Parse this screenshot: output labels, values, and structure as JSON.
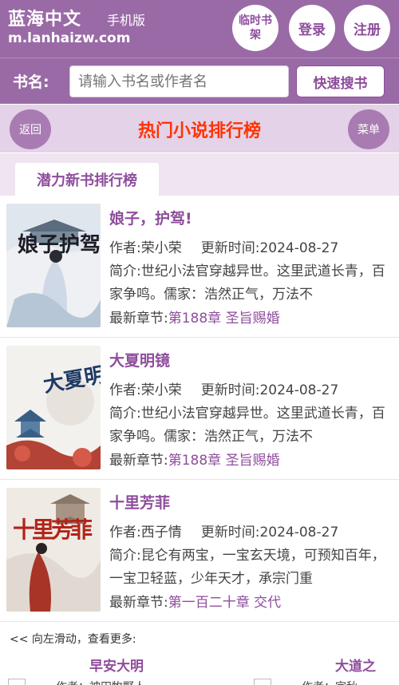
{
  "header": {
    "site_name": "蓝海中文",
    "site_sub": "手机版",
    "site_url": "m.lanhaizw.com",
    "btn_shelf": "临时书架",
    "btn_login": "登录",
    "btn_register": "注册"
  },
  "search": {
    "label": "书名:",
    "placeholder": "请输入书名或作者名",
    "button": "快速搜书"
  },
  "titlebar": {
    "back": "返回",
    "title": "热门小说排行榜",
    "menu": "菜单"
  },
  "tab": {
    "label": "潜力新书排行榜"
  },
  "books": [
    {
      "title": "娘子，护驾!",
      "author_label": "作者:",
      "author": "荣小荣",
      "update_label": "更新时间:",
      "update": "2024-08-27",
      "intro_label": "简介:",
      "intro": "世纪小法官穿越异世。这里武道长青，百家争鸣。儒家：浩然正气，万法不",
      "chapter_label": "最新章节:",
      "chapter": "第188章 圣旨赐婚",
      "cover_text": "娘子护驾"
    },
    {
      "title": "大夏明镜",
      "author_label": "作者:",
      "author": "荣小荣",
      "update_label": "更新时间:",
      "update": "2024-08-27",
      "intro_label": "简介:",
      "intro": "世纪小法官穿越异世。这里武道长青，百家争鸣。儒家：浩然正气，万法不",
      "chapter_label": "最新章节:",
      "chapter": "第188章 圣旨赐婚",
      "cover_text": "大夏明镜"
    },
    {
      "title": "十里芳菲",
      "author_label": "作者:",
      "author": "西子情",
      "update_label": "更新时间:",
      "update": "2024-08-27",
      "intro_label": "简介:",
      "intro": "昆仑有两宝，一宝玄天境，可预知百年，一宝卫轻蓝，少年天才，承宗门重",
      "chapter_label": "最新章节:",
      "chapter": "第一百二十章 交代",
      "cover_text": "十里芳菲"
    }
  ],
  "swipe": {
    "hint": "<< 向左滑动，查看更多:",
    "item1": "早安大明",
    "item2": "大道之",
    "item1_sub": "作者：神田牧野人",
    "item2_sub": "作者：宗秋"
  }
}
